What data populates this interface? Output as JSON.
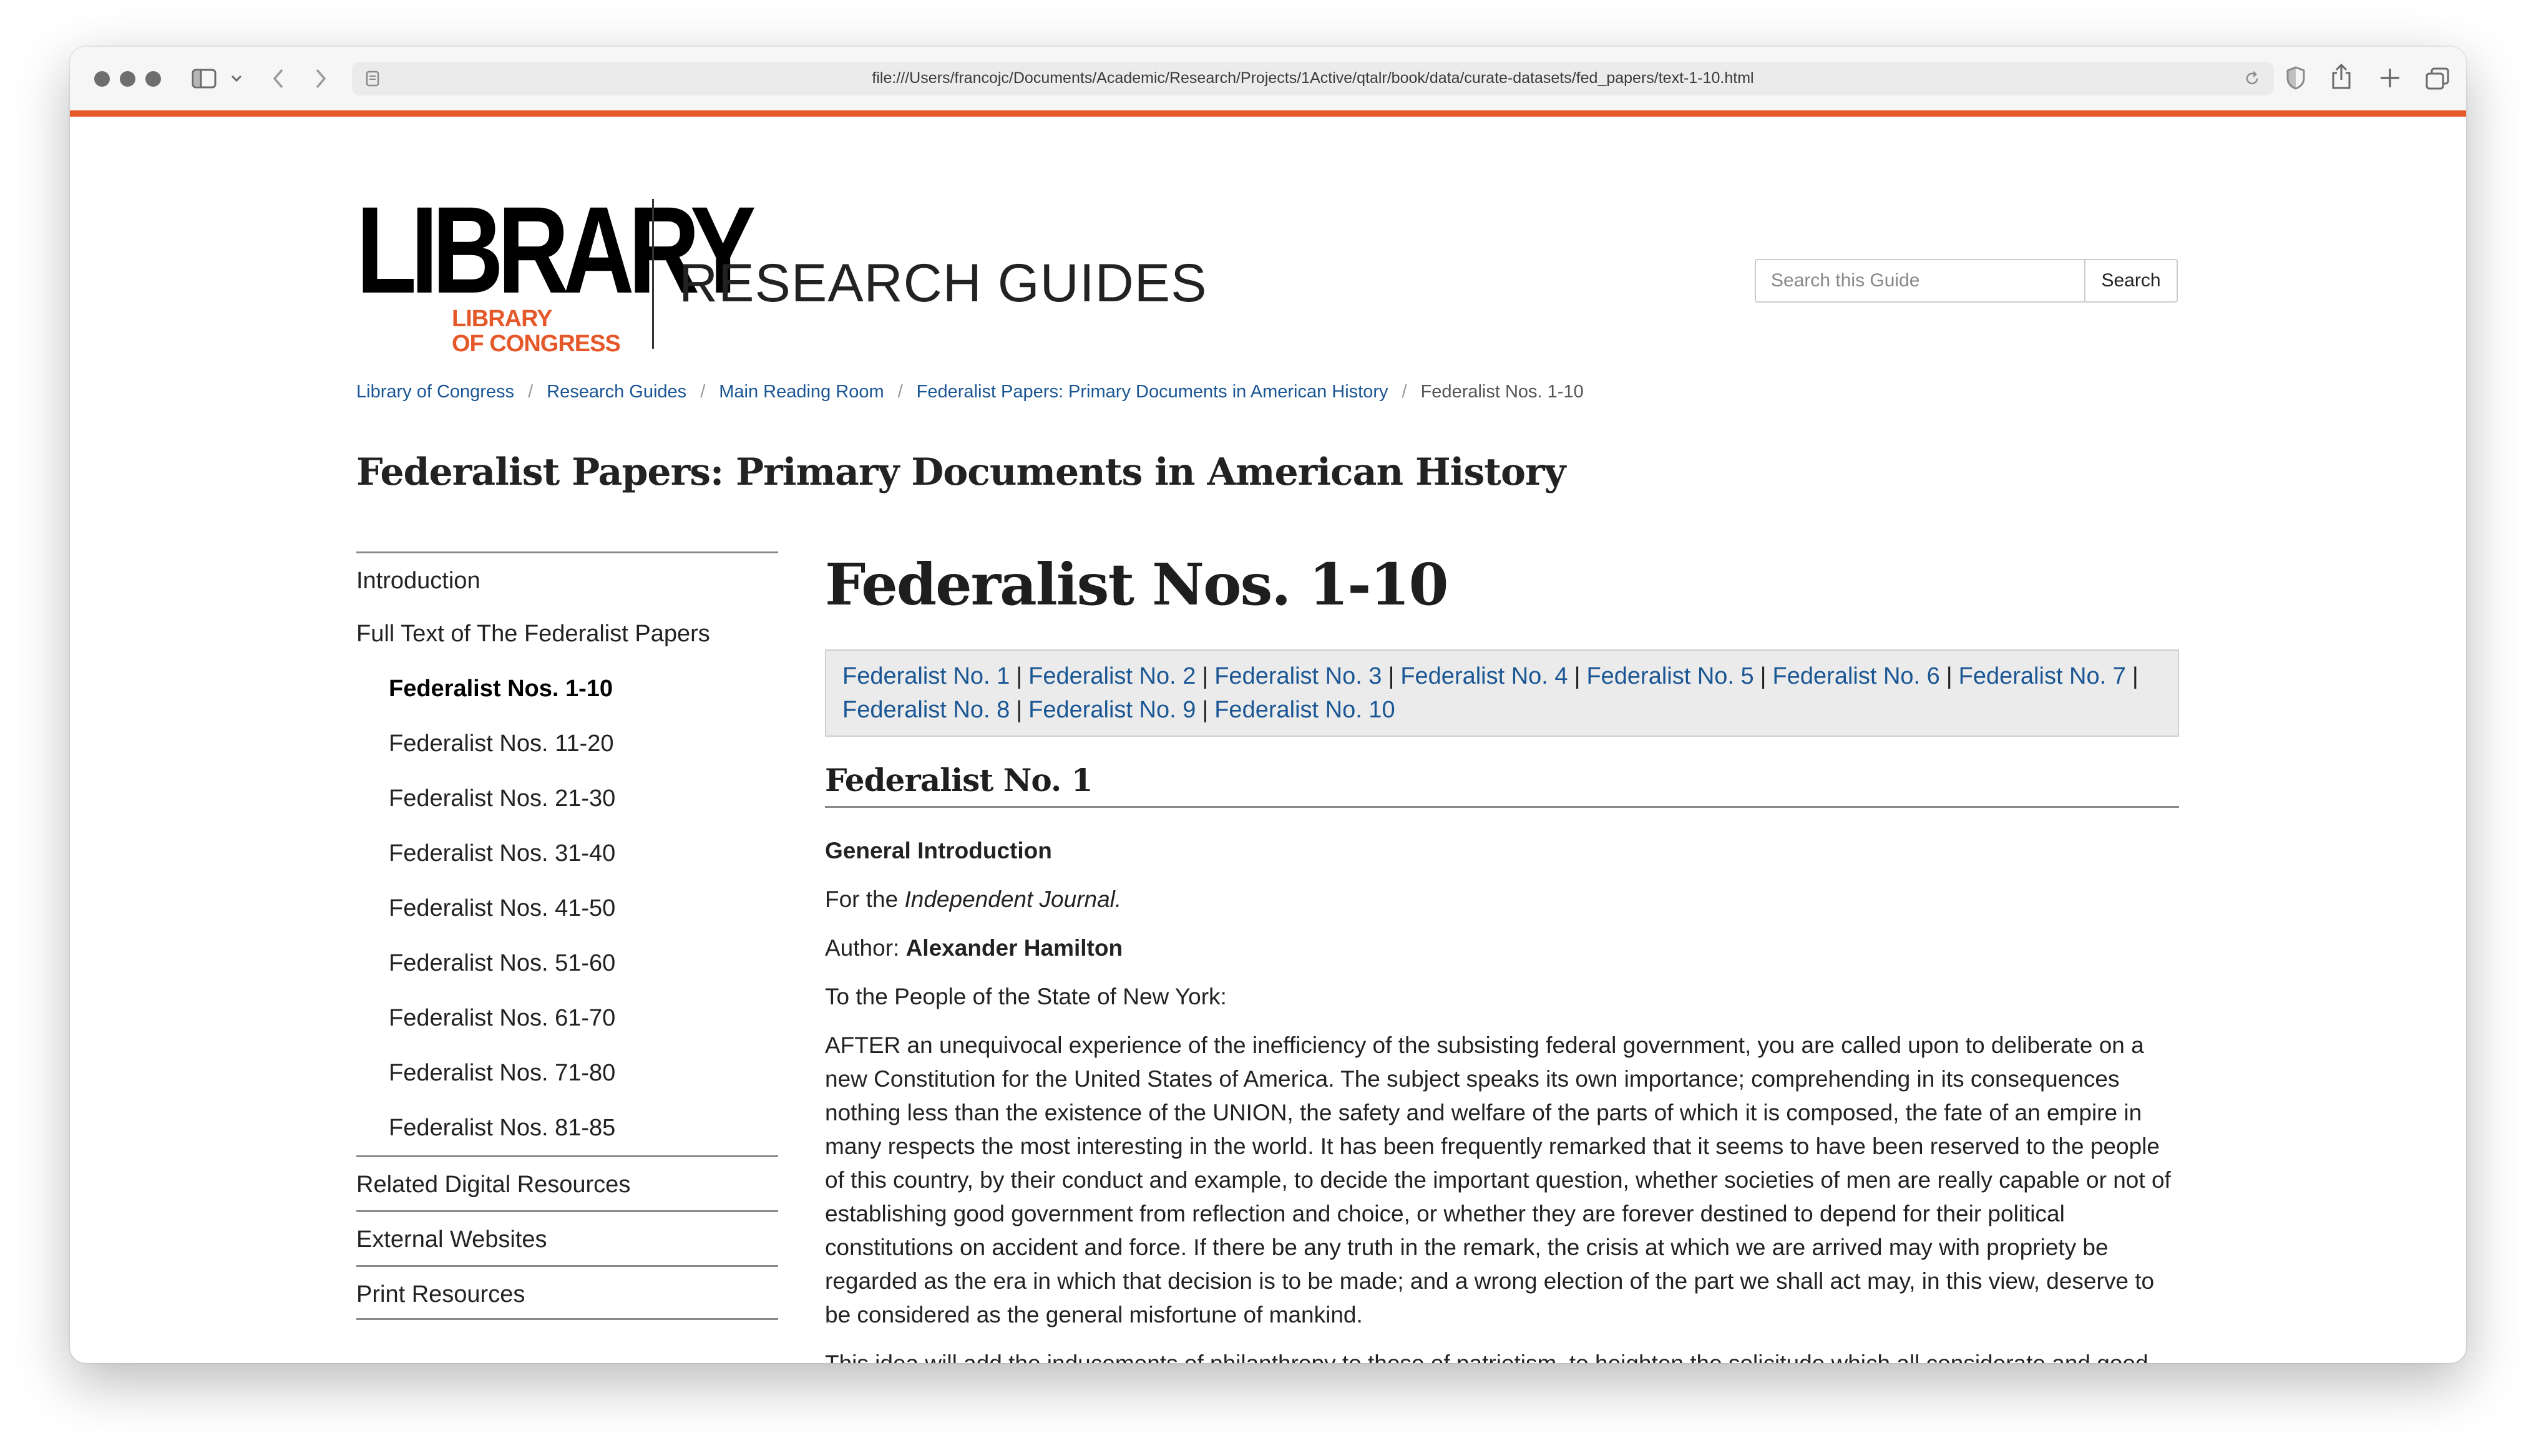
{
  "browser": {
    "address_url": "file:///Users/francojc/Documents/Academic/Research/Projects/1Active/qtalr/book/data/curate-datasets/fed_papers/text-1-10.html"
  },
  "header": {
    "logo_word": "LIBRARY",
    "logo_sub_line1": "LIBRARY",
    "logo_sub_line2": "OF CONGRESS",
    "title": "RESEARCH GUIDES",
    "search_placeholder": "Search this Guide",
    "search_button": "Search"
  },
  "breadcrumb": [
    {
      "label": "Library of Congress"
    },
    {
      "label": "Research Guides"
    },
    {
      "label": "Main Reading Room"
    },
    {
      "label": "Federalist Papers: Primary Documents in American History"
    },
    {
      "label": "Federalist Nos. 1-10"
    }
  ],
  "guide_title": "Federalist Papers: Primary Documents in American History",
  "sidebar": {
    "items": [
      {
        "label": "Introduction"
      },
      {
        "label": "Full Text of The Federalist Papers"
      },
      {
        "label": "Federalist Nos. 1-10"
      },
      {
        "label": "Federalist Nos. 11-20"
      },
      {
        "label": "Federalist Nos. 21-30"
      },
      {
        "label": "Federalist Nos. 31-40"
      },
      {
        "label": "Federalist Nos. 41-50"
      },
      {
        "label": "Federalist Nos. 51-60"
      },
      {
        "label": "Federalist Nos. 61-70"
      },
      {
        "label": "Federalist Nos. 71-80"
      },
      {
        "label": "Federalist Nos. 81-85"
      },
      {
        "label": "Related Digital Resources"
      },
      {
        "label": "External Websites"
      },
      {
        "label": "Print Resources"
      }
    ]
  },
  "main": {
    "heading": "Federalist Nos. 1-10",
    "separator": "|",
    "jump_links": [
      "Federalist No. 1",
      "Federalist No. 2",
      "Federalist No. 3",
      "Federalist No. 4",
      "Federalist No. 5",
      "Federalist No. 6",
      "Federalist No. 7",
      "Federalist No. 8",
      "Federalist No. 9",
      "Federalist No. 10"
    ],
    "section_heading": "Federalist No. 1",
    "subtitle": "General Introduction",
    "for_prefix": "For the ",
    "for_journal": "Independent Journal.",
    "author_prefix": "Author: ",
    "author_name": "Alexander Hamilton",
    "salutation": "To the People of the State of New York:",
    "paragraph1": "AFTER an unequivocal experience of the inefficiency of the subsisting federal government, you are called upon to deliberate on a new Constitution for the United States of America. The subject speaks its own importance; comprehending in its consequences nothing less than the existence of the UNION, the safety and welfare of the parts of which it is composed, the fate of an empire in many respects the most interesting in the world. It has been frequently remarked that it seems to have been reserved to the people of this country, by their conduct and example, to decide the important question, whether societies of men are really capable or not of establishing good government from reflection and choice, or whether they are forever destined to depend for their political constitutions on accident and force. If there be any truth in the remark, the crisis at which we are arrived may with propriety be regarded as the era in which that decision is to be made; and a wrong election of the part we shall act may, in this view, deserve to be considered as the general misfortune of mankind.",
    "paragraph2": "This idea will add the inducements of philanthropy to those of patriotism, to heighten the solicitude which all considerate and good men must feel for the event. Happy will it be if our choice should be directed by a judicious estimate of our true interests"
  }
}
